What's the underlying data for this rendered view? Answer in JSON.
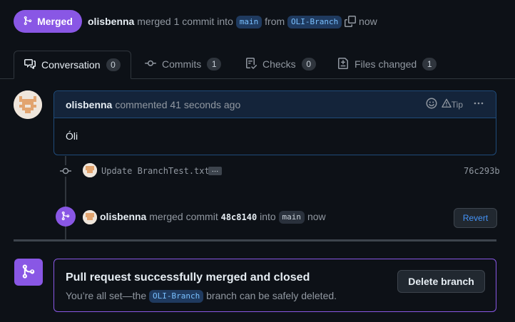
{
  "header": {
    "status_label": "Merged",
    "author": "olisbenna",
    "action_text": "merged 1 commit into",
    "base_branch": "main",
    "from_text": "from",
    "head_branch": "OLI-Branch",
    "time": "now"
  },
  "tabs": [
    {
      "label": "Conversation",
      "count": "0"
    },
    {
      "label": "Commits",
      "count": "1"
    },
    {
      "label": "Checks",
      "count": "0"
    },
    {
      "label": "Files changed",
      "count": "1"
    }
  ],
  "comment": {
    "author": "olisbenna",
    "meta": "commented 41 seconds ago",
    "tip_label": "Tip",
    "body": "Óli"
  },
  "commit": {
    "message": "Update BranchTest.txt",
    "ellipsis": "…",
    "sha": "76c293b"
  },
  "merge_event": {
    "author": "olisbenna",
    "text1": "merged commit",
    "sha": "48c8140",
    "text2": "into",
    "branch": "main",
    "time": "now",
    "revert_label": "Revert"
  },
  "merged_panel": {
    "title": "Pull request successfully merged and closed",
    "text_before": "You’re all set—the",
    "branch": "OLI-Branch",
    "text_after": "branch can be safely deleted.",
    "delete_label": "Delete branch"
  },
  "colors": {
    "merged_purple": "#8957e5",
    "link_blue": "#4493f8",
    "background": "#0d1117"
  }
}
